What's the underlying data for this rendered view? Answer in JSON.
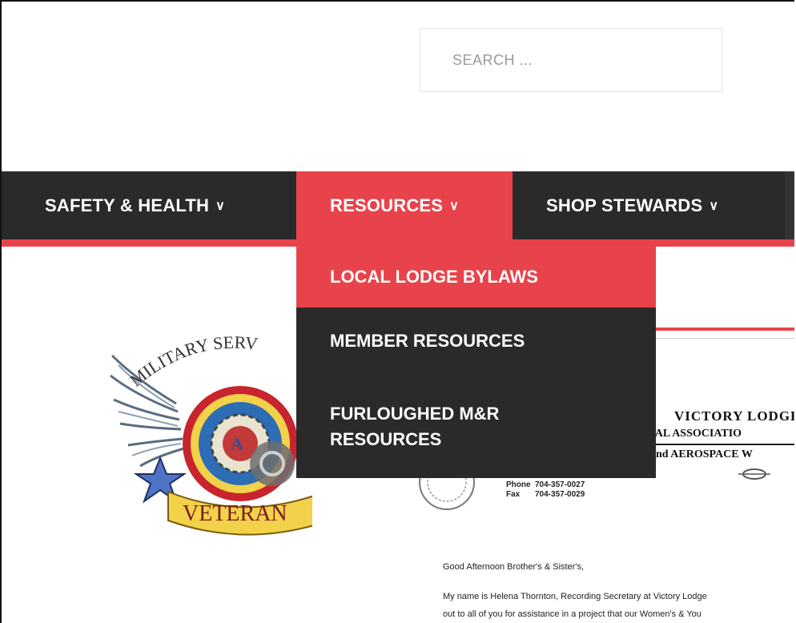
{
  "search": {
    "placeholder": "SEARCH ..."
  },
  "nav": {
    "items": [
      {
        "label": "SAFETY & HEALTH"
      },
      {
        "label": "RESOURCES"
      },
      {
        "label": "SHOP STEWARDS"
      }
    ],
    "chevron": "∨"
  },
  "dropdown": {
    "items": [
      {
        "label": "LOCAL LODGE BYLAWS"
      },
      {
        "label": "MEMBER RESOURCES"
      },
      {
        "label": "FURLOUGHED M&R RESOURCES"
      }
    ]
  },
  "emblem": {
    "top_text": "MILITARY SERV",
    "bottom_text": "VETERAN"
  },
  "letterhead": {
    "title": "VICTORY LODGE",
    "subtitle": "TIONAL ASSOCIATIO",
    "subtitle2": "and AEROSPACE W",
    "phone_label": "Phone",
    "phone": "704-357-0027",
    "fax_label": "Fax",
    "fax": "704-357-0029"
  },
  "letter": {
    "greeting": "Good Afternoon Brother's & Sister's,",
    "line1": "My name is Helena Thornton, Recording Secretary at Victory Lodge",
    "line2": "out to all of you for assistance in a project that our Women's & You"
  },
  "colors": {
    "accent": "#e8434b",
    "nav_bg": "#2a2a2a"
  }
}
